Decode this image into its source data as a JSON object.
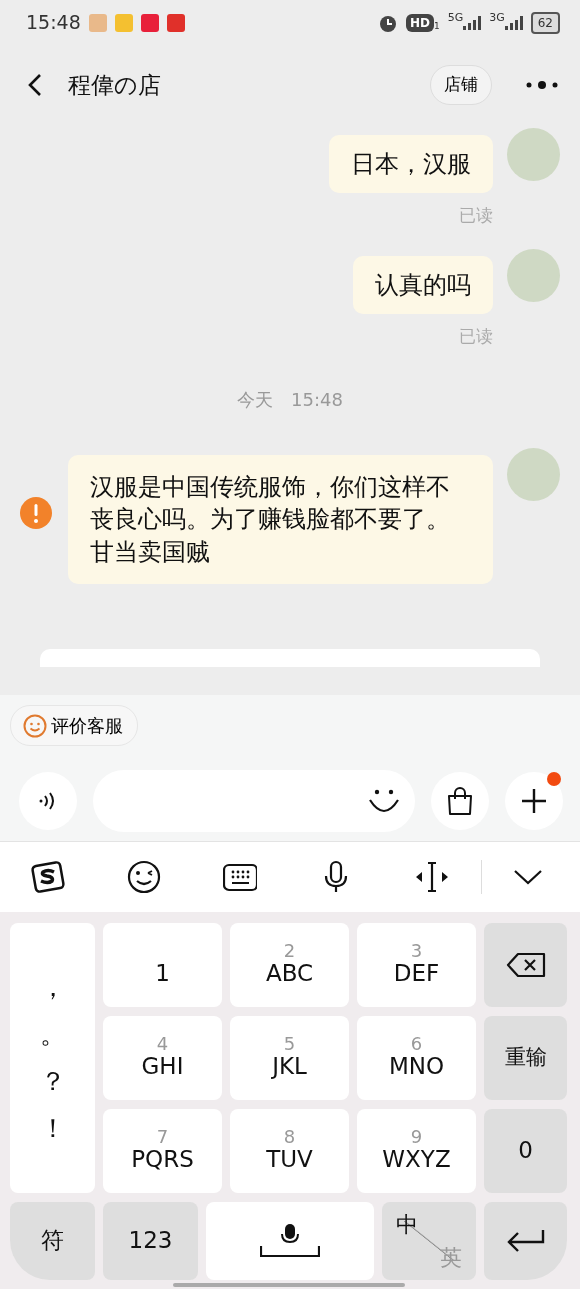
{
  "status_bar": {
    "time": "15:48",
    "hd": "HD",
    "hd_sub": "1",
    "net_1": "5G",
    "net_2": "3G",
    "battery": "62"
  },
  "header": {
    "title": "程偉の店",
    "shop_button": "店铺"
  },
  "messages": [
    {
      "kind": "bubble",
      "text": "日本，汉服",
      "read": "已读",
      "failed": false
    },
    {
      "kind": "bubble",
      "text": "认真的吗",
      "read": "已读",
      "failed": false
    },
    {
      "kind": "time",
      "day": "今天",
      "time": "15:48"
    },
    {
      "kind": "bubble",
      "text": "汉服是中国传统服饰，你们这样不丧良心吗。为了赚钱脸都不要了。甘当卖国贼",
      "failed": true
    }
  ],
  "quick_reply": {
    "label": "评价客服"
  },
  "plus_badge": true,
  "keyboard": {
    "symbols": [
      "，",
      "。",
      "？",
      "！"
    ],
    "one_key": "1",
    "keys": [
      {
        "digit": "2",
        "letters": "ABC"
      },
      {
        "digit": "3",
        "letters": "DEF"
      },
      {
        "digit": "4",
        "letters": "GHI"
      },
      {
        "digit": "5",
        "letters": "JKL"
      },
      {
        "digit": "6",
        "letters": "MNO"
      },
      {
        "digit": "7",
        "letters": "PQRS"
      },
      {
        "digit": "8",
        "letters": "TUV"
      },
      {
        "digit": "9",
        "letters": "WXYZ"
      }
    ],
    "reset": "重输",
    "zero": "0",
    "symbol_key": "符",
    "number_key": "123",
    "lang_on": "中",
    "lang_off": "英"
  }
}
